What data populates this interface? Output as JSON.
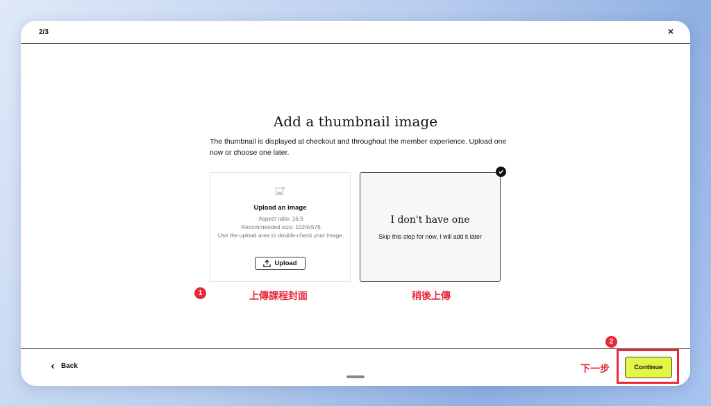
{
  "header": {
    "step": "2/3",
    "close_icon": "×"
  },
  "main": {
    "title": "Add a thumbnail image",
    "description": "The thumbnail is displayed at checkout and throughout the member experience. Upload one now or choose one later.",
    "upload_card": {
      "title": "Upload an image",
      "aspect_ratio": "Aspect ratio: 16:9",
      "recommended_size": "Recommended size: 1024x576",
      "hint": "Use the upload area to double-check your image.",
      "upload_label": "Upload",
      "icon": "image-icon"
    },
    "none_card": {
      "title": "I don't have one",
      "subtitle": "Skip this step for now, I will add it later",
      "selected": true
    }
  },
  "annotations": {
    "badge1": "1",
    "label1": "上傳課程封面",
    "label_skip": "稍後上傳",
    "badge2": "2",
    "label_next": "下一步",
    "color": "#e8293a"
  },
  "footer": {
    "back_label": "Back",
    "continue_label": "Continue",
    "continue_color": "#e4f545"
  }
}
